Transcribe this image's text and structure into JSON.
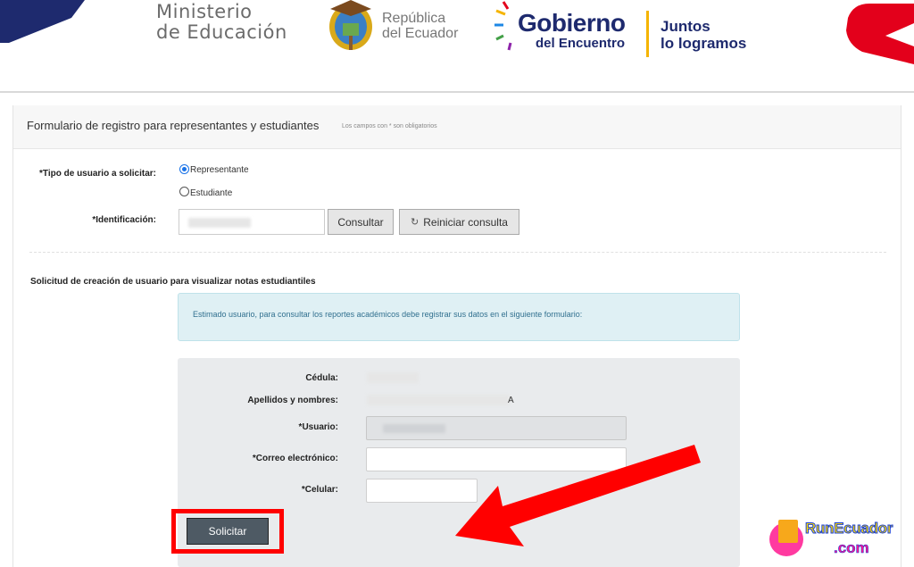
{
  "header": {
    "ministry_line1": "Ministerio",
    "ministry_line2": "de Educación",
    "republic_line1": "República",
    "republic_line2": "del Ecuador",
    "gob_title": "Gobierno",
    "gob_sub": "del Encuentro",
    "slogan_line1": "Juntos",
    "slogan_line2": "lo logramos",
    "accent_red": "#e3001b",
    "accent_navy": "#1e2a6e"
  },
  "form": {
    "title": "Formulario de registro para representantes y estudiantes",
    "required_note": "Los campos con * son obligatorios",
    "user_type_label": "*Tipo de usuario a solicitar:",
    "user_type_options": [
      "Representante",
      "Estudiante"
    ],
    "user_type_selected": "Representante",
    "id_label": "*Identificación:",
    "consult_button": "Consultar",
    "reset_button": "Reiniciar consulta",
    "reset_icon": "refresh-icon"
  },
  "request": {
    "section_title": "Solicitud de creación de usuario para visualizar notas estudiantiles",
    "info_text": "Estimado usuario, para consultar los reportes académicos debe registrar sus datos en el siguiente formulario:",
    "cedula_label": "Cédula:",
    "names_label": "Apellidos y nombres:",
    "names_tail": "A",
    "user_label": "*Usuario:",
    "email_label": "*Correo electrónico:",
    "phone_label": "*Celular:",
    "submit_button": "Solicitar",
    "highlight_color": "#ff0000"
  },
  "watermark": {
    "line1": "RunEcuador",
    "line2": ".com"
  }
}
